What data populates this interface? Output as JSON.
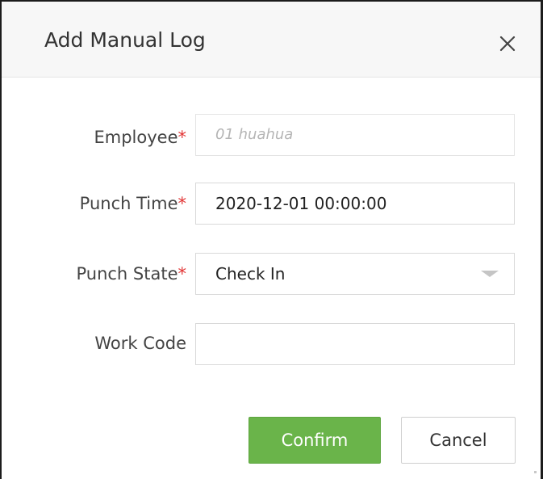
{
  "dialog": {
    "title": "Add Manual Log",
    "close_icon": "close-icon"
  },
  "form": {
    "employee": {
      "label": "Employee",
      "required_mark": "*",
      "placeholder": "01 huahua",
      "value": ""
    },
    "punch_time": {
      "label": "Punch Time",
      "required_mark": "*",
      "value": "2020-12-01 00:00:00"
    },
    "punch_state": {
      "label": "Punch State",
      "required_mark": "*",
      "selected": "Check In",
      "dropdown_icon": "caret-down-icon"
    },
    "work_code": {
      "label": "Work Code",
      "value": ""
    }
  },
  "actions": {
    "confirm_label": "Confirm",
    "cancel_label": "Cancel"
  },
  "colors": {
    "confirm_bg": "#6ab44a",
    "required": "#e23434",
    "header_bg": "#f7f7f7"
  }
}
